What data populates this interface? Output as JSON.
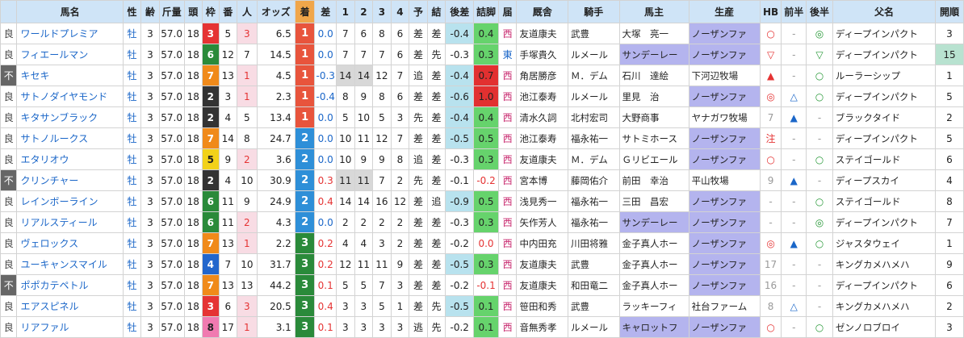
{
  "headers": [
    "",
    "馬名",
    "性",
    "齢",
    "斤量",
    "頭",
    "枠",
    "番",
    "人",
    "オッズ",
    "着",
    "差",
    "1",
    "2",
    "3",
    "4",
    "予",
    "結",
    "後差",
    "詰脚",
    "届",
    "厩舎",
    "騎手",
    "馬主",
    "生産",
    "HB",
    "前半",
    "後半",
    "父名",
    "開順"
  ],
  "colors": {
    "header_bg": "#cfe4f7",
    "waku": {
      "2": "#333333",
      "3": "#e53333",
      "4": "#2266cc",
      "5": "#f2d21a",
      "6": "#2a8a3a",
      "7": "#f08a1a",
      "8": "#f07ab0"
    },
    "rank": {
      "1": "#e8543c",
      "2": "#2e8fd8",
      "3": "#2a8a3a"
    },
    "detail_green": "#66d36c",
    "detail_red": "#e23030",
    "owner_purple": "#b4b4ee"
  },
  "rows": [
    {
      "cond": "良",
      "name": "ワールドプレミア",
      "sex": "牡",
      "age": "3",
      "weight": "57.0",
      "field": "18",
      "waku": "3",
      "num": "5",
      "pop": "3",
      "odds": "6.5",
      "rank": "1",
      "diff": "0.0",
      "c1": "7",
      "c2": "6",
      "c3": "8",
      "c4": "6",
      "pred": "差",
      "res": "差",
      "kosa": "-0.4",
      "tsume": "0.4",
      "todoke": "西",
      "stable": "友道康夫",
      "jockey": "武豊",
      "owner": "大塚　亮一",
      "breeder": "ノーザンファ",
      "hb": "○",
      "zen": "-",
      "kou": "◎",
      "sire": "ディープインパクト",
      "kai": "3"
    },
    {
      "cond": "良",
      "name": "フィエールマン",
      "sex": "牡",
      "age": "3",
      "weight": "57.0",
      "field": "18",
      "waku": "6",
      "num": "12",
      "pop": "7",
      "odds": "14.5",
      "rank": "1",
      "diff": "0.0",
      "c1": "7",
      "c2": "7",
      "c3": "7",
      "c4": "6",
      "pred": "差",
      "res": "先",
      "kosa": "-0.3",
      "tsume": "0.3",
      "todoke": "東",
      "stable": "手塚貴久",
      "jockey": "ルメール",
      "owner": "サンデーレー",
      "breeder": "ノーザンファ",
      "hb": "▽",
      "zen": "-",
      "kou": "▽",
      "sire": "ディープインパクト",
      "kai": "15"
    },
    {
      "cond": "不",
      "name": "キセキ",
      "sex": "牡",
      "age": "3",
      "weight": "57.0",
      "field": "18",
      "waku": "7",
      "num": "13",
      "pop": "1",
      "odds": "4.5",
      "rank": "1",
      "diff": "-0.3",
      "c1": "14",
      "c2": "14",
      "c3": "12",
      "c4": "7",
      "pred": "追",
      "res": "差",
      "kosa": "-0.4",
      "tsume": "0.7",
      "todoke": "西",
      "stable": "角居勝彦",
      "jockey": "Ｍ．デム",
      "owner": "石川　達絵",
      "breeder": "下河辺牧場",
      "hb": "▲",
      "zen": "-",
      "kou": "○",
      "sire": "ルーラーシップ",
      "kai": "1"
    },
    {
      "cond": "良",
      "name": "サトノダイヤモンド",
      "sex": "牡",
      "age": "3",
      "weight": "57.0",
      "field": "18",
      "waku": "2",
      "num": "3",
      "pop": "1",
      "odds": "2.3",
      "rank": "1",
      "diff": "-0.4",
      "c1": "8",
      "c2": "9",
      "c3": "8",
      "c4": "6",
      "pred": "差",
      "res": "差",
      "kosa": "-0.6",
      "tsume": "1.0",
      "todoke": "西",
      "stable": "池江泰寿",
      "jockey": "ルメール",
      "owner": "里見　治",
      "breeder": "ノーザンファ",
      "hb": "◎",
      "zen": "△",
      "kou": "○",
      "sire": "ディープインパクト",
      "kai": "5"
    },
    {
      "cond": "良",
      "name": "キタサンブラック",
      "sex": "牡",
      "age": "3",
      "weight": "57.0",
      "field": "18",
      "waku": "2",
      "num": "4",
      "pop": "5",
      "odds": "13.4",
      "rank": "1",
      "diff": "0.0",
      "c1": "5",
      "c2": "10",
      "c3": "5",
      "c4": "3",
      "pred": "先",
      "res": "差",
      "kosa": "-0.4",
      "tsume": "0.4",
      "todoke": "西",
      "stable": "清水久詞",
      "jockey": "北村宏司",
      "owner": "大野商事",
      "breeder": "ヤナガワ牧場",
      "hb": "7",
      "zen": "▲",
      "kou": "-",
      "sire": "ブラックタイド",
      "kai": "2"
    },
    {
      "cond": "良",
      "name": "サトノルークス",
      "sex": "牡",
      "age": "3",
      "weight": "57.0",
      "field": "18",
      "waku": "7",
      "num": "14",
      "pop": "8",
      "odds": "24.7",
      "rank": "2",
      "diff": "0.0",
      "c1": "10",
      "c2": "11",
      "c3": "12",
      "c4": "7",
      "pred": "差",
      "res": "差",
      "kosa": "-0.5",
      "tsume": "0.5",
      "todoke": "西",
      "stable": "池江泰寿",
      "jockey": "福永祐一",
      "owner": "サトミホース",
      "breeder": "ノーザンファ",
      "hb": "注",
      "zen": "-",
      "kou": "-",
      "sire": "ディープインパクト",
      "kai": "5"
    },
    {
      "cond": "良",
      "name": "エタリオウ",
      "sex": "牡",
      "age": "3",
      "weight": "57.0",
      "field": "18",
      "waku": "5",
      "num": "9",
      "pop": "2",
      "odds": "3.6",
      "rank": "2",
      "diff": "0.0",
      "c1": "10",
      "c2": "9",
      "c3": "9",
      "c4": "8",
      "pred": "追",
      "res": "差",
      "kosa": "-0.3",
      "tsume": "0.3",
      "todoke": "西",
      "stable": "友道康夫",
      "jockey": "Ｍ．デム",
      "owner": "Ｇリビエール",
      "breeder": "ノーザンファ",
      "hb": "○",
      "zen": "-",
      "kou": "○",
      "sire": "ステイゴールド",
      "kai": "6"
    },
    {
      "cond": "不",
      "name": "クリンチャー",
      "sex": "牡",
      "age": "3",
      "weight": "57.0",
      "field": "18",
      "waku": "2",
      "num": "4",
      "pop": "10",
      "odds": "30.9",
      "rank": "2",
      "diff": "0.3",
      "c1": "11",
      "c2": "11",
      "c3": "7",
      "c4": "2",
      "pred": "先",
      "res": "差",
      "kosa": "-0.1",
      "tsume": "-0.2",
      "todoke": "西",
      "stable": "宮本博",
      "jockey": "藤岡佑介",
      "owner": "前田　幸治",
      "breeder": "平山牧場",
      "hb": "9",
      "zen": "▲",
      "kou": "-",
      "sire": "ディープスカイ",
      "kai": "4"
    },
    {
      "cond": "良",
      "name": "レインボーライン",
      "sex": "牡",
      "age": "3",
      "weight": "57.0",
      "field": "18",
      "waku": "6",
      "num": "11",
      "pop": "9",
      "odds": "24.9",
      "rank": "2",
      "diff": "0.4",
      "c1": "14",
      "c2": "14",
      "c3": "16",
      "c4": "12",
      "pred": "差",
      "res": "追",
      "kosa": "-0.9",
      "tsume": "0.5",
      "todoke": "西",
      "stable": "浅見秀一",
      "jockey": "福永祐一",
      "owner": "三田　昌宏",
      "breeder": "ノーザンファ",
      "hb": "-",
      "zen": "-",
      "kou": "○",
      "sire": "ステイゴールド",
      "kai": "8"
    },
    {
      "cond": "良",
      "name": "リアルスティール",
      "sex": "牡",
      "age": "3",
      "weight": "57.0",
      "field": "18",
      "waku": "6",
      "num": "11",
      "pop": "2",
      "odds": "4.3",
      "rank": "2",
      "diff": "0.0",
      "c1": "2",
      "c2": "2",
      "c3": "2",
      "c4": "2",
      "pred": "差",
      "res": "差",
      "kosa": "-0.3",
      "tsume": "0.3",
      "todoke": "西",
      "stable": "矢作芳人",
      "jockey": "福永祐一",
      "owner": "サンデーレー",
      "breeder": "ノーザンファ",
      "hb": "-",
      "zen": "-",
      "kou": "◎",
      "sire": "ディープインパクト",
      "kai": "7"
    },
    {
      "cond": "良",
      "name": "ヴェロックス",
      "sex": "牡",
      "age": "3",
      "weight": "57.0",
      "field": "18",
      "waku": "7",
      "num": "13",
      "pop": "1",
      "odds": "2.2",
      "rank": "3",
      "diff": "0.2",
      "c1": "4",
      "c2": "4",
      "c3": "3",
      "c4": "2",
      "pred": "差",
      "res": "差",
      "kosa": "-0.2",
      "tsume": "0.0",
      "todoke": "西",
      "stable": "中内田充",
      "jockey": "川田将雅",
      "owner": "金子真人ホー",
      "breeder": "ノーザンファ",
      "hb": "◎",
      "zen": "▲",
      "kou": "○",
      "sire": "ジャスタウェイ",
      "kai": "1"
    },
    {
      "cond": "良",
      "name": "ユーキャンスマイル",
      "sex": "牡",
      "age": "3",
      "weight": "57.0",
      "field": "18",
      "waku": "4",
      "num": "7",
      "pop": "10",
      "odds": "31.7",
      "rank": "3",
      "diff": "0.2",
      "c1": "12",
      "c2": "11",
      "c3": "11",
      "c4": "9",
      "pred": "差",
      "res": "差",
      "kosa": "-0.5",
      "tsume": "0.3",
      "todoke": "西",
      "stable": "友道康夫",
      "jockey": "武豊",
      "owner": "金子真人ホー",
      "breeder": "ノーザンファ",
      "hb": "17",
      "zen": "-",
      "kou": "-",
      "sire": "キングカメハメハ",
      "kai": "9"
    },
    {
      "cond": "不",
      "name": "ポポカテペトル",
      "sex": "牡",
      "age": "3",
      "weight": "57.0",
      "field": "18",
      "waku": "7",
      "num": "13",
      "pop": "13",
      "odds": "44.2",
      "rank": "3",
      "diff": "0.1",
      "c1": "5",
      "c2": "5",
      "c3": "7",
      "c4": "3",
      "pred": "差",
      "res": "差",
      "kosa": "-0.2",
      "tsume": "-0.1",
      "todoke": "西",
      "stable": "友道康夫",
      "jockey": "和田竜二",
      "owner": "金子真人ホー",
      "breeder": "ノーザンファ",
      "hb": "16",
      "zen": "-",
      "kou": "-",
      "sire": "ディープインパクト",
      "kai": "6"
    },
    {
      "cond": "良",
      "name": "エアスピネル",
      "sex": "牡",
      "age": "3",
      "weight": "57.0",
      "field": "18",
      "waku": "3",
      "num": "6",
      "pop": "3",
      "odds": "20.5",
      "rank": "3",
      "diff": "0.4",
      "c1": "3",
      "c2": "3",
      "c3": "5",
      "c4": "1",
      "pred": "差",
      "res": "先",
      "kosa": "-0.5",
      "tsume": "0.1",
      "todoke": "西",
      "stable": "笹田和秀",
      "jockey": "武豊",
      "owner": "ラッキーフィ",
      "breeder": "社台ファーム",
      "hb": "8",
      "zen": "△",
      "kou": "-",
      "sire": "キングカメハメハ",
      "kai": "2"
    },
    {
      "cond": "良",
      "name": "リアファル",
      "sex": "牡",
      "age": "3",
      "weight": "57.0",
      "field": "18",
      "waku": "8",
      "num": "17",
      "pop": "1",
      "odds": "3.1",
      "rank": "3",
      "diff": "0.1",
      "c1": "3",
      "c2": "3",
      "c3": "3",
      "c4": "3",
      "pred": "逃",
      "res": "先",
      "kosa": "-0.2",
      "tsume": "0.1",
      "todoke": "西",
      "stable": "音無秀孝",
      "jockey": "ルメール",
      "owner": "キャロットフ",
      "breeder": "ノーザンファ",
      "hb": "○",
      "zen": "-",
      "kou": "○",
      "sire": "ゼンノロブロイ",
      "kai": "3"
    }
  ]
}
